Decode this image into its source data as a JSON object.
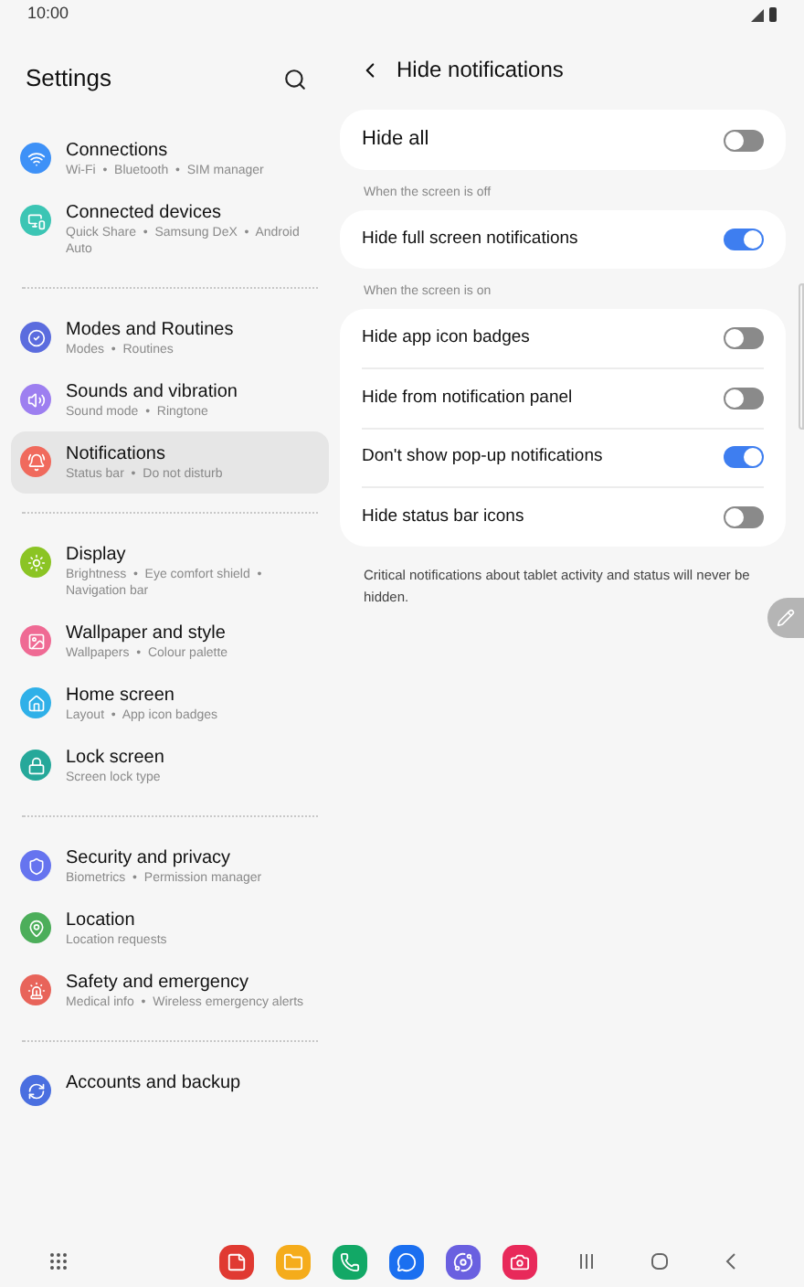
{
  "status_bar": {
    "time": "10:00"
  },
  "sidebar": {
    "title": "Settings",
    "groups": [
      [
        {
          "title": "Connections",
          "subtitle": "Wi-Fi  •  Bluetooth  •  SIM manager",
          "color": "#3e91f7",
          "selected": false
        },
        {
          "title": "Connected devices",
          "subtitle": "Quick Share  •  Samsung DeX  •  Android Auto",
          "color": "#3cc5b4",
          "selected": false
        }
      ],
      [
        {
          "title": "Modes and Routines",
          "subtitle": "Modes  •  Routines",
          "color": "#5b6cde",
          "selected": false
        },
        {
          "title": "Sounds and vibration",
          "subtitle": "Sound mode  •  Ringtone",
          "color": "#9d7ff0",
          "selected": false
        },
        {
          "title": "Notifications",
          "subtitle": "Status bar  •  Do not disturb",
          "color": "#f06a5d",
          "selected": true
        }
      ],
      [
        {
          "title": "Display",
          "subtitle": "Brightness  •  Eye comfort shield  •  Navigation bar",
          "color": "#8bc424",
          "selected": false
        },
        {
          "title": "Wallpaper and style",
          "subtitle": "Wallpapers  •  Colour palette",
          "color": "#ef6a94",
          "selected": false
        },
        {
          "title": "Home screen",
          "subtitle": "Layout  •  App icon badges",
          "color": "#2fb0e8",
          "selected": false
        },
        {
          "title": "Lock screen",
          "subtitle": "Screen lock type",
          "color": "#26a89a",
          "selected": false
        }
      ],
      [
        {
          "title": "Security and privacy",
          "subtitle": "Biometrics  •  Permission manager",
          "color": "#6674ef",
          "selected": false
        },
        {
          "title": "Location",
          "subtitle": "Location requests",
          "color": "#4cae5a",
          "selected": false
        },
        {
          "title": "Safety and emergency",
          "subtitle": "Medical info  •  Wireless emergency alerts",
          "color": "#e8645a",
          "selected": false
        }
      ],
      [
        {
          "title": "Accounts and backup",
          "color": "#4a6fe0",
          "selected": false
        }
      ]
    ]
  },
  "panel": {
    "title": "Hide notifications",
    "sections": [
      {
        "rows": [
          {
            "label": "Hide all",
            "on": false
          }
        ]
      },
      {
        "heading": "When the screen is off",
        "rows": [
          {
            "label": "Hide full screen notifications",
            "on": true
          }
        ]
      },
      {
        "heading": "When the screen is on",
        "rows": [
          {
            "label": "Hide app icon badges",
            "on": false
          },
          {
            "label": "Hide from notification panel",
            "on": false
          },
          {
            "label": "Don't show pop-up notifications",
            "on": true
          },
          {
            "label": "Hide status bar icons",
            "on": false
          }
        ]
      }
    ],
    "footnote": "Critical notifications about tablet activity and status will never be hidden."
  },
  "taskbar": {
    "apps": [
      {
        "color": "#e03a32"
      },
      {
        "color": "#f5ac1b"
      },
      {
        "color": "#12a866"
      },
      {
        "color": "#1b6ff0"
      },
      {
        "color": "#6a60e0"
      },
      {
        "color": "#e8295a"
      }
    ]
  }
}
